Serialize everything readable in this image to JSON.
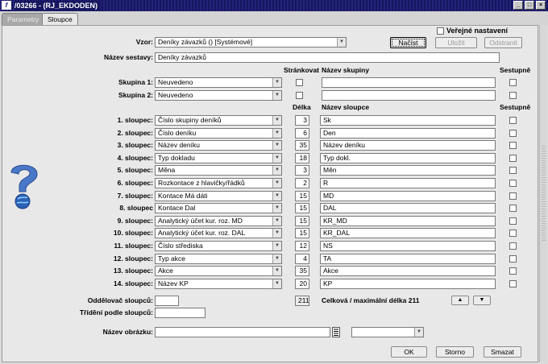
{
  "window": {
    "title": "/03266 - (RJ_EKDODEN)",
    "app_icon": "f",
    "buttons": {
      "minimize": "_",
      "maximize": "□",
      "close": "×"
    }
  },
  "tabs": [
    {
      "label": "Parametry",
      "active": false
    },
    {
      "label": "Sloupce",
      "active": true
    }
  ],
  "header": {
    "verejne_label": "Veřejné nastavení",
    "vzor_label": "Vzor:",
    "vzor_value": "Deníky závazků   ()   [Systémové]",
    "nacist_label": "Načíst",
    "ulozit_label": "Uložit",
    "odstranit_label": "Odstranit",
    "nazev_sestavy_label": "Název sestavy:",
    "nazev_sestavy_value": "Deníky závazků"
  },
  "groups": {
    "col_strankovat": "Stránkovat",
    "col_nazev_skupiny": "Název skupiny",
    "col_sestupne": "Sestupně",
    "rows": [
      {
        "label": "Skupina 1:",
        "value": "Neuvedeno"
      },
      {
        "label": "Skupina 2:",
        "value": "Neuvedeno"
      }
    ]
  },
  "columns": {
    "col_delka": "Délka",
    "col_nazev_sloupce": "Název sloupce",
    "col_sestupne": "Sestupně",
    "rows": [
      {
        "label": "1. sloupec:",
        "value": "Číslo skupiny deníků",
        "length": "3",
        "name": "Sk"
      },
      {
        "label": "2. sloupec:",
        "value": "Číslo deníku",
        "length": "6",
        "name": "Den"
      },
      {
        "label": "3. sloupec:",
        "value": "Název deníku",
        "length": "35",
        "name": "Název deníku"
      },
      {
        "label": "4. sloupec:",
        "value": "Typ dokladu",
        "length": "18",
        "name": "Typ dokl."
      },
      {
        "label": "5. sloupec:",
        "value": "Měna",
        "length": "3",
        "name": "Měn"
      },
      {
        "label": "6. sloupec:",
        "value": "Rozkontace z hlavičky/řádků",
        "length": "2",
        "name": "R"
      },
      {
        "label": "7. sloupec:",
        "value": "Kontace Má dáti",
        "length": "15",
        "name": "MD"
      },
      {
        "label": "8. sloupec",
        "value": "Kontace Dal",
        "length": "15",
        "name": "DAL"
      },
      {
        "label": "9. sloupec:",
        "value": "Analytický účet kur. roz. MD",
        "length": "15",
        "name": "KR_MD"
      },
      {
        "label": "10. sloupec:",
        "value": "Analytický účet kur. roz. DAL",
        "length": "15",
        "name": "KR_DAL"
      },
      {
        "label": "11. sloupec:",
        "value": "Číslo střediska",
        "length": "12",
        "name": "NS"
      },
      {
        "label": "12. sloupec:",
        "value": "Typ akce",
        "length": "4",
        "name": "TA"
      },
      {
        "label": "13. sloupec:",
        "value": "Akce",
        "length": "35",
        "name": "Akce"
      },
      {
        "label": "14. sloupec:",
        "value": "Název KP",
        "length": "20",
        "name": "KP"
      }
    ]
  },
  "footer": {
    "oddelovac_label": "Oddělovač sloupců:",
    "oddelovac_value": "",
    "total_length": "211",
    "total_label": "Celková / maximální délka 211",
    "trideni_label": "Třídění podle sloupců:",
    "trideni_value": "",
    "nazev_obrazku_label": "Název obrázku:",
    "nazev_obrazku_value": "",
    "ok_label": "OK",
    "storno_label": "Storno",
    "smazat_label": "Smazat",
    "up_arrow": "▲",
    "down_arrow": "▼"
  },
  "icons": {
    "help": "help-question-icon",
    "dropdown": "▼",
    "list": "list-icon"
  }
}
